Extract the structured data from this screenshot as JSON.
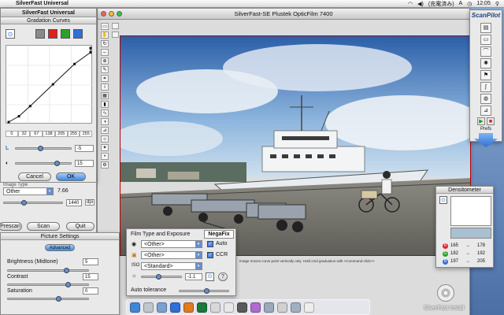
{
  "menubar": {
    "app_name": "SilverFast Universal",
    "ime_status": "(充電済み)",
    "input_mode": "A",
    "clock": "12:05",
    "spotlight": "⚲"
  },
  "main_window": {
    "title": "SilverFast-SE Plustek OpticFilm 7400",
    "status_text": "Image moves curve point vertically only. Hold cmd graduation with <Command-click>>"
  },
  "gradation": {
    "title": "Gradation Curves",
    "swatch_colors": [
      "#808080",
      "#e0201b",
      "#2aa02a",
      "#2f6fd8"
    ],
    "x_values": [
      "0",
      "32",
      "67",
      "138",
      "205",
      "255",
      "255"
    ],
    "curve_points": [
      [
        0,
        0
      ],
      [
        32,
        20
      ],
      [
        67,
        55
      ],
      [
        138,
        130
      ],
      [
        205,
        200
      ],
      [
        255,
        240
      ],
      [
        255,
        255
      ]
    ],
    "sliders": [
      {
        "name": "lightness",
        "icon": "L",
        "value": "-5",
        "pos": 0.4
      },
      {
        "name": "shadow",
        "icon": "◐",
        "value": "15",
        "pos": 0.7
      }
    ],
    "cancel_label": "Cancel",
    "ok_label": "OK"
  },
  "universal": {
    "source_label": "Other",
    "source_value": "7.66",
    "resolution_value": "1440",
    "resolution_unit": "dpi",
    "prescan_label": "Prescan",
    "scan_label": "Scan",
    "quit_label": "Quit",
    "partial_label": "Image Type"
  },
  "picture_settings": {
    "title": "Picture Settings",
    "advanced_label": "Advanced",
    "rows": [
      {
        "label": "Brightness (Midtone)",
        "value": "5"
      },
      {
        "label": "Contrast",
        "value": "15"
      },
      {
        "label": "Saturation",
        "value": "0"
      }
    ]
  },
  "film_type": {
    "title": "Film Type and Exposure",
    "brand": "NegaFix",
    "selects": [
      "<Other>",
      "<Other>",
      "<Standard>"
    ],
    "auto_label": "Auto",
    "ccr_label": "CCR",
    "exposure_value": "-1.1",
    "help_label": "?",
    "auto_tolerance_label": "Auto tolerance"
  },
  "scanpilot": {
    "title": "ScanPilot",
    "prefs_label": "Prefs"
  },
  "densitometer": {
    "title": "Densitometer",
    "rows": [
      {
        "channel": "R",
        "color": "#e02222",
        "before": "165",
        "after": "178"
      },
      {
        "channel": "G",
        "color": "#2aa02a",
        "before": "182",
        "after": "192"
      },
      {
        "channel": "B",
        "color": "#2f6fd8",
        "before": "197",
        "after": "205"
      }
    ]
  },
  "desktop": {
    "install_label": "SilverFast Install"
  }
}
